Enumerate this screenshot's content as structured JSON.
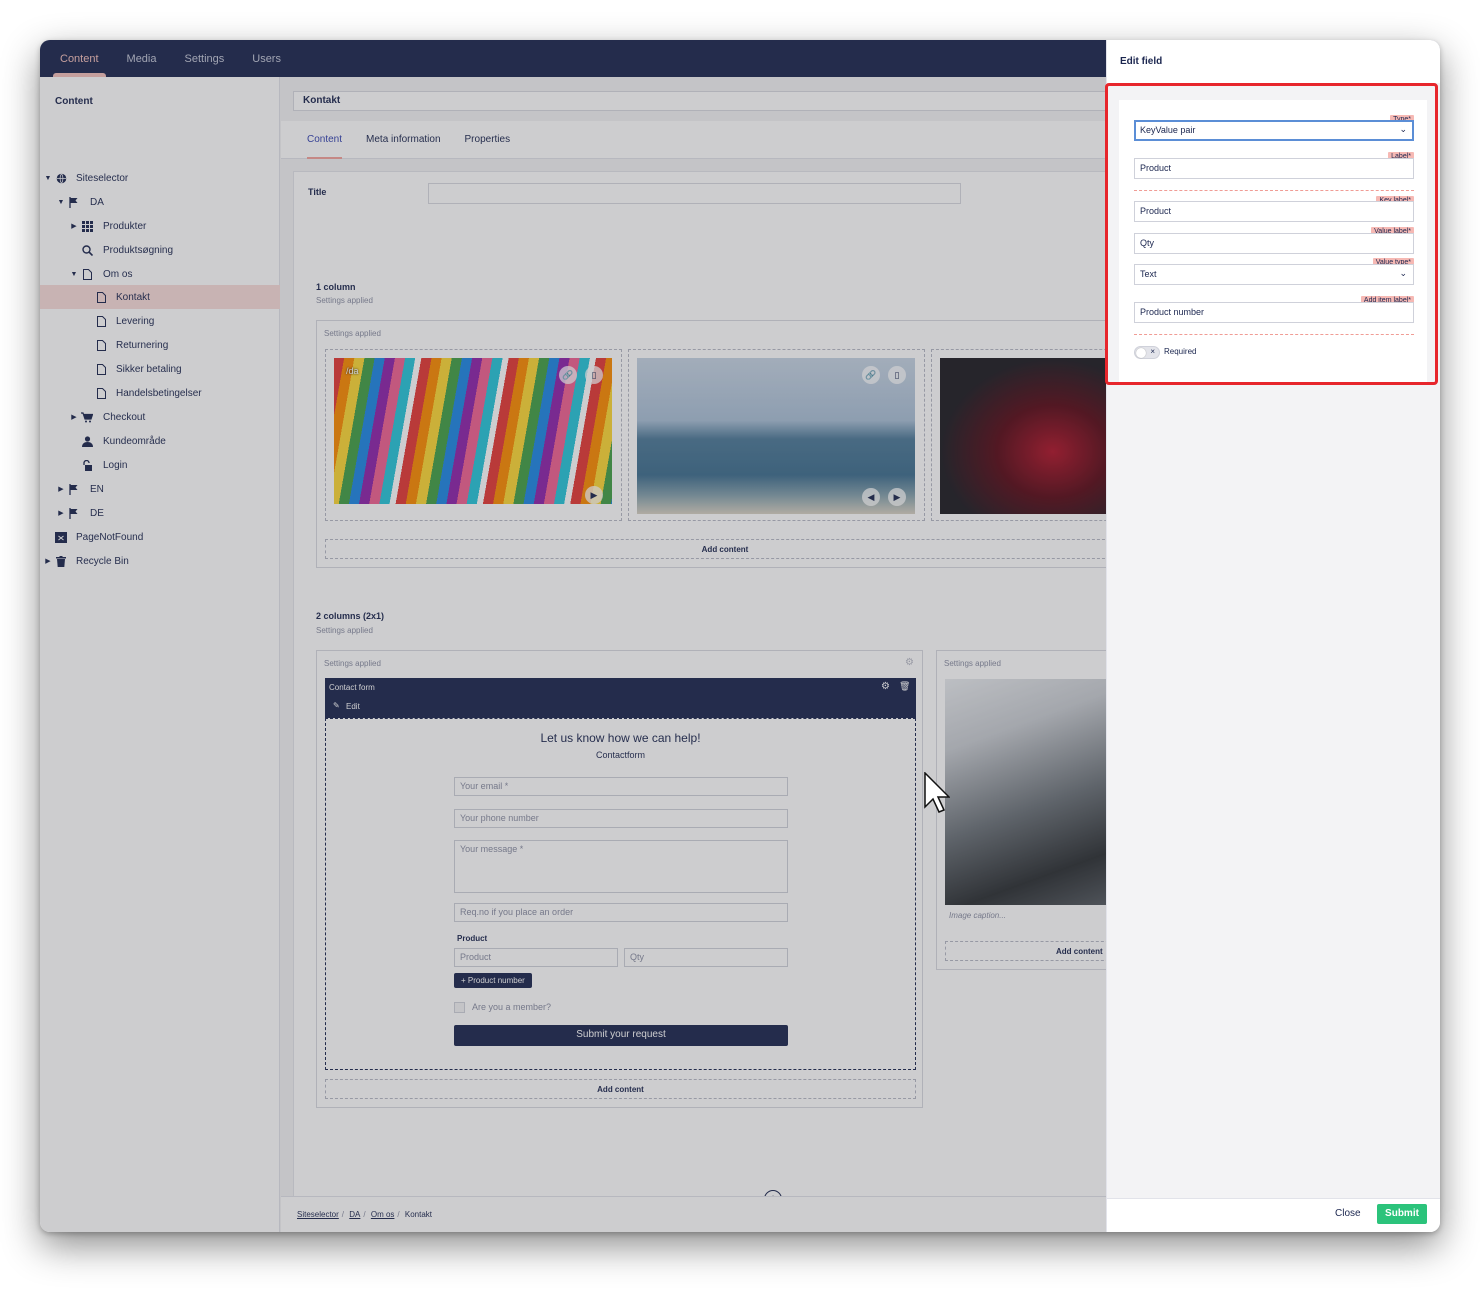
{
  "header": {
    "nav": [
      "Content",
      "Media",
      "Settings",
      "Users"
    ],
    "active": "Content"
  },
  "sidebar": {
    "title": "Content",
    "tree": [
      {
        "label": "Siteselector",
        "icon": "globe-icon"
      },
      {
        "label": "DA",
        "icon": "flag-icon"
      },
      {
        "label": "Produkter",
        "icon": "grid-icon"
      },
      {
        "label": "Produktsøgning",
        "icon": "search-icon"
      },
      {
        "label": "Om os",
        "icon": "document-icon"
      },
      {
        "label": "Kontakt",
        "icon": "document-icon"
      },
      {
        "label": "Levering",
        "icon": "document-icon"
      },
      {
        "label": "Returnering",
        "icon": "document-icon"
      },
      {
        "label": "Sikker betaling",
        "icon": "document-icon"
      },
      {
        "label": "Handelsbetingelser",
        "icon": "document-icon"
      },
      {
        "label": "Checkout",
        "icon": "cart-icon"
      },
      {
        "label": "Kundeområde",
        "icon": "user-icon"
      },
      {
        "label": "Login",
        "icon": "lock-icon"
      },
      {
        "label": "EN",
        "icon": "flag-icon"
      },
      {
        "label": "DE",
        "icon": "flag-icon"
      },
      {
        "label": "PageNotFound",
        "icon": "not-found-icon"
      },
      {
        "label": "Recycle Bin",
        "icon": "trash-icon"
      }
    ]
  },
  "editor": {
    "doc_name": "Kontakt",
    "tabs": [
      "Content",
      "Meta information",
      "Properties"
    ],
    "title_label": "Title",
    "section1": {
      "title": "1 column",
      "subtitle": "Settings applied",
      "area_label": "Settings applied",
      "image_caption_overlay": "/da",
      "add_content": "Add content"
    },
    "section2": {
      "title": "2 columns (2x1)",
      "subtitle": "Settings applied",
      "left_area_label": "Settings applied",
      "right_area_label": "Settings applied",
      "block_title": "Contact form",
      "edit_label": "Edit",
      "form": {
        "heading": "Let us know how we can help!",
        "subheading": "Contactform",
        "email_placeholder": "Your email *",
        "phone_placeholder": "Your phone number",
        "message_placeholder": "Your message *",
        "reqno_placeholder": "Req.no if you place an order",
        "product_label": "Product",
        "product_placeholder": "Product",
        "qty_placeholder": "Qty",
        "add_product_label": "+ Product number",
        "member_label": "Are you a member?",
        "submit_label": "Submit your request"
      },
      "image_caption": "Image caption...",
      "add_content_left": "Add content",
      "add_content_right": "Add content"
    }
  },
  "breadcrumbs": {
    "items": [
      "Siteselector",
      "DA",
      "Om os"
    ],
    "current": "Kontakt"
  },
  "panel": {
    "title": "Edit field",
    "type_tag": "Type*",
    "type_value": "KeyValue pair",
    "label_tag": "Label*",
    "label_value": "Product",
    "key_label_tag": "Key label*",
    "key_label_value": "Product",
    "value_label_tag": "Value label*",
    "value_label_value": "Qty",
    "value_type_tag": "Value type*",
    "value_type_value": "Text",
    "add_item_label_tag": "Add item label*",
    "add_item_label_value": "Product number",
    "required_label": "Required",
    "close_label": "Close",
    "submit_label": "Submit"
  },
  "colors": {
    "nav_bg": "#1b264f",
    "accent": "#f5c1bc",
    "highlight_frame": "#e7262c",
    "submit_green": "#2bc37b"
  }
}
